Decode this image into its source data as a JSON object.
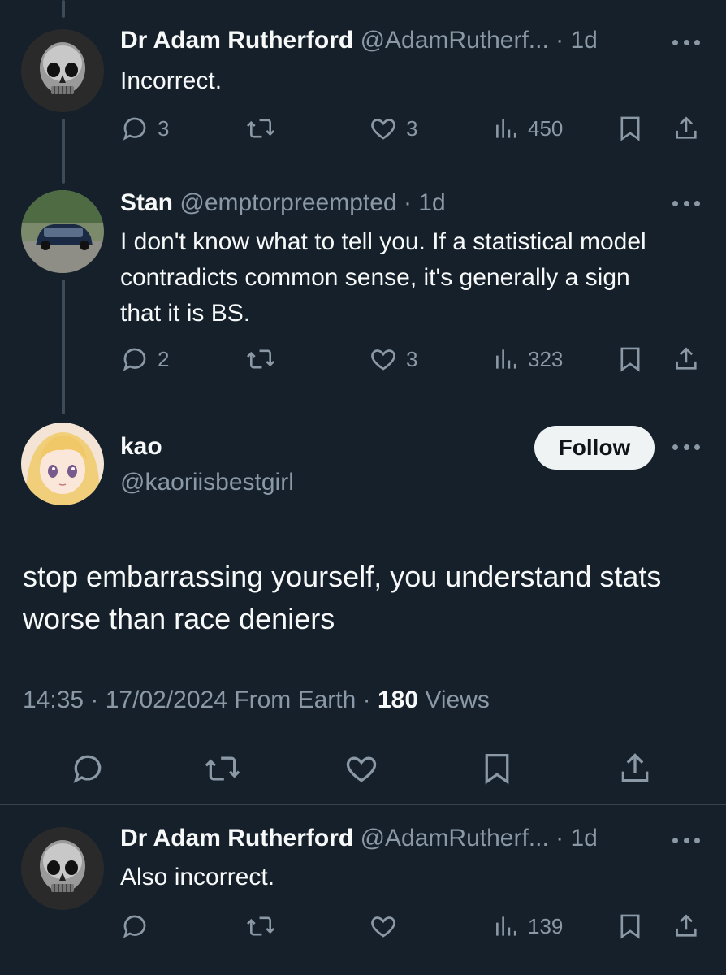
{
  "tweets": [
    {
      "name": "Dr Adam Rutherford",
      "handle": "@AdamRutherf...",
      "sep": " · ",
      "time": "1d",
      "text": "Incorrect.",
      "replies": "3",
      "retweets": "",
      "likes": "3",
      "views": "450"
    },
    {
      "name": "Stan",
      "handle": "@emptorpreempted",
      "sep": " · ",
      "time": "1d",
      "text": "I don't know what to tell you.  If a statistical model contradicts common sense, it's generally a sign that it is BS.",
      "replies": "2",
      "retweets": "",
      "likes": "3",
      "views": "323"
    }
  ],
  "main": {
    "name": "kao",
    "handle": "@kaoriisbestgirl",
    "follow_label": "Follow",
    "text": "stop embarrassing yourself, you understand stats worse than race deniers",
    "time": "14:35",
    "date": "17/02/2024",
    "source": "From Earth",
    "views_count": "180",
    "views_label": "Views",
    "dot": " · "
  },
  "reply": {
    "name": "Dr Adam Rutherford",
    "handle": "@AdamRutherf...",
    "sep": " · ",
    "time": "1d",
    "text": "Also incorrect.",
    "replies": "",
    "retweets": "",
    "likes": "",
    "views": "139"
  },
  "icons": {
    "reply": "reply-icon",
    "retweet": "retweet-icon",
    "like": "heart-icon",
    "views": "views-icon",
    "bookmark": "bookmark-icon",
    "share": "share-icon",
    "more": "more-icon"
  },
  "colors": {
    "background": "#15202b",
    "muted": "#8b98a5",
    "text": "#f7f9f9",
    "thread_line": "#3d4a58"
  }
}
